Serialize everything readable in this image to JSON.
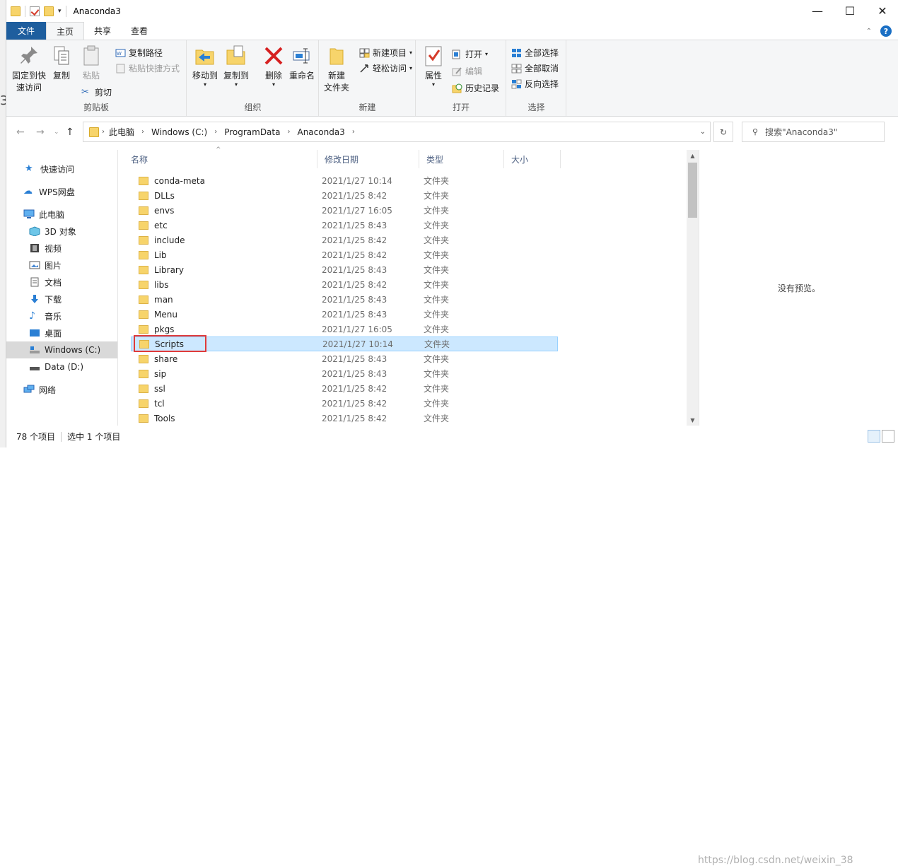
{
  "window": {
    "title": "Anaconda3"
  },
  "window_buttons": {
    "minimize": "—",
    "maximize": "☐",
    "close": "✕"
  },
  "tabs": [
    {
      "label": "文件"
    },
    {
      "label": "主页"
    },
    {
      "label": "共享"
    },
    {
      "label": "查看"
    }
  ],
  "ribbon": {
    "clipboard": {
      "label": "剪贴板",
      "pin_line1": "固定到快",
      "pin_line2": "速访问",
      "copy": "复制",
      "paste": "粘贴",
      "copy_path": "复制路径",
      "paste_shortcut": "粘贴快捷方式",
      "cut": "剪切"
    },
    "organize": {
      "label": "组织",
      "move_to": "移动到",
      "copy_to": "复制到",
      "delete": "删除",
      "rename": "重命名"
    },
    "new": {
      "label": "新建",
      "new_folder_line1": "新建",
      "new_folder_line2": "文件夹",
      "new_item": "新建项目",
      "easy_access": "轻松访问"
    },
    "open": {
      "label": "打开",
      "properties": "属性",
      "open": "打开",
      "edit": "编辑",
      "history": "历史记录"
    },
    "select": {
      "label": "选择",
      "select_all": "全部选择",
      "select_none": "全部取消",
      "invert": "反向选择"
    }
  },
  "address": {
    "crumbs": [
      "此电脑",
      "Windows (C:)",
      "ProgramData",
      "Anaconda3"
    ]
  },
  "search": {
    "placeholder": "搜索\"Anaconda3\""
  },
  "navpane": {
    "items": [
      {
        "label": "快速访问"
      },
      {
        "label": "WPS网盘"
      },
      {
        "label": "此电脑"
      },
      {
        "label": "3D 对象"
      },
      {
        "label": "视频"
      },
      {
        "label": "图片"
      },
      {
        "label": "文档"
      },
      {
        "label": "下载"
      },
      {
        "label": "音乐"
      },
      {
        "label": "桌面"
      },
      {
        "label": "Windows (C:)"
      },
      {
        "label": "Data (D:)"
      },
      {
        "label": "网络"
      }
    ]
  },
  "columns": {
    "name": "名称",
    "date": "修改日期",
    "type": "类型",
    "size": "大小"
  },
  "files": [
    {
      "name": "conda-meta",
      "date": "2021/1/27 10:14",
      "type": "文件夹"
    },
    {
      "name": "DLLs",
      "date": "2021/1/25 8:42",
      "type": "文件夹"
    },
    {
      "name": "envs",
      "date": "2021/1/27 16:05",
      "type": "文件夹"
    },
    {
      "name": "etc",
      "date": "2021/1/25 8:43",
      "type": "文件夹"
    },
    {
      "name": "include",
      "date": "2021/1/25 8:42",
      "type": "文件夹"
    },
    {
      "name": "Lib",
      "date": "2021/1/25 8:42",
      "type": "文件夹"
    },
    {
      "name": "Library",
      "date": "2021/1/25 8:43",
      "type": "文件夹"
    },
    {
      "name": "libs",
      "date": "2021/1/25 8:42",
      "type": "文件夹"
    },
    {
      "name": "man",
      "date": "2021/1/25 8:43",
      "type": "文件夹"
    },
    {
      "name": "Menu",
      "date": "2021/1/25 8:43",
      "type": "文件夹"
    },
    {
      "name": "pkgs",
      "date": "2021/1/27 16:05",
      "type": "文件夹"
    },
    {
      "name": "Scripts",
      "date": "2021/1/27 10:14",
      "type": "文件夹"
    },
    {
      "name": "share",
      "date": "2021/1/25 8:43",
      "type": "文件夹"
    },
    {
      "name": "sip",
      "date": "2021/1/25 8:43",
      "type": "文件夹"
    },
    {
      "name": "ssl",
      "date": "2021/1/25 8:42",
      "type": "文件夹"
    },
    {
      "name": "tcl",
      "date": "2021/1/25 8:42",
      "type": "文件夹"
    },
    {
      "name": "Tools",
      "date": "2021/1/25 8:42",
      "type": "文件夹"
    }
  ],
  "preview": {
    "text": "没有预览。"
  },
  "status": {
    "count": "78 个项目",
    "selected": "选中 1 个项目"
  },
  "watermark": "https://blog.csdn.net/weixin_38"
}
